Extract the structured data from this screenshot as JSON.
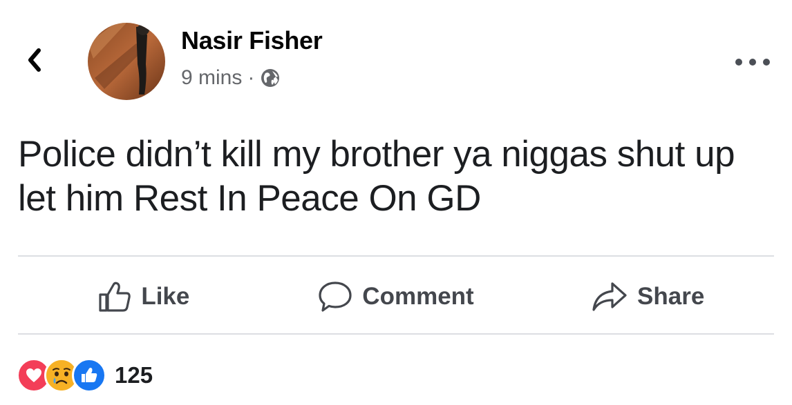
{
  "post": {
    "author": "Nasir Fisher",
    "time": "9 mins",
    "separator": "·",
    "privacy_icon": "globe-icon",
    "text": "Police didn’t kill my brother ya niggas shut up let him Rest In Peace On GD"
  },
  "actions": {
    "like_label": "Like",
    "comment_label": "Comment",
    "share_label": "Share"
  },
  "reactions": {
    "icons": [
      "love-icon",
      "sad-icon",
      "like-icon"
    ],
    "count": "125"
  },
  "colors": {
    "love": "#f33e58",
    "sad": "#f7b125",
    "like": "#1877f2",
    "secondary_text": "#65676b",
    "divider": "#dcdee2"
  }
}
